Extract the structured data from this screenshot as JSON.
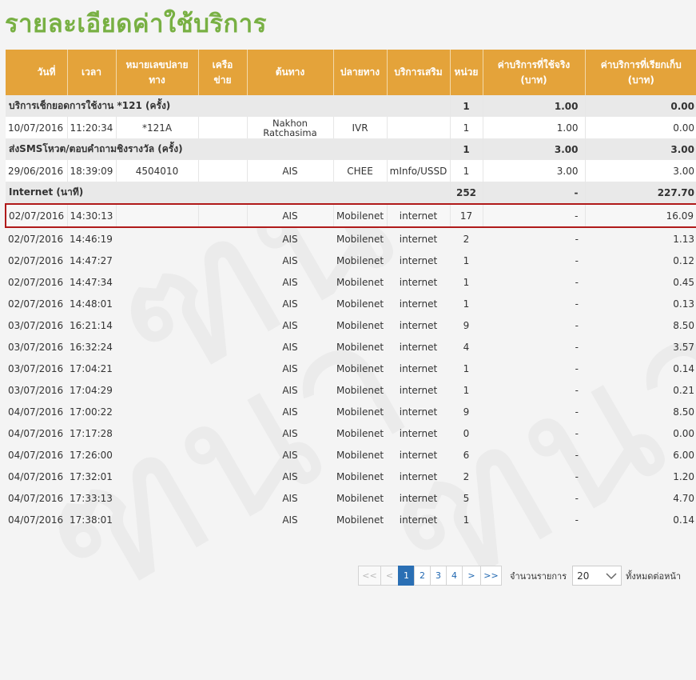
{
  "page": {
    "title": "รายละเอียดค่าใช้บริการ"
  },
  "table": {
    "headers": [
      "วันที่",
      "เวลา",
      "หมายเลขปลายทาง",
      "เครือข่าย",
      "ต้นทาง",
      "ปลายทาง",
      "บริการเสริม",
      "หน่วย",
      "ค่าบริการที่ใช้จริง (บาท)",
      "ค่าบริการที่เรียกเก็บ (บาท)"
    ],
    "groups": [
      {
        "title": "บริการเช็กยอดการใช้งาน *121 (ครั้ง)",
        "units": "1",
        "actual": "1.00",
        "charged": "0.00"
      },
      {
        "title": "ส่งSMSโหวต/ตอบคำถามชิงรางวัล (ครั้ง)",
        "units": "1",
        "actual": "3.00",
        "charged": "3.00"
      },
      {
        "title": "Internet (นาที)",
        "units": "252",
        "actual": "-",
        "charged": "227.70"
      }
    ],
    "group1_rows": [
      {
        "date": "10/07/2016",
        "time": "11:20:34",
        "number": "*121A",
        "network": "",
        "origin": "Nakhon Ratchasima",
        "dest": "IVR",
        "addon": "",
        "units": "1",
        "actual": "1.00",
        "charged": "0.00"
      }
    ],
    "group2_rows": [
      {
        "date": "29/06/2016",
        "time": "18:39:09",
        "number": "4504010",
        "network": "",
        "origin": "AIS",
        "dest": "CHEE",
        "addon": "mInfo/USSD",
        "units": "1",
        "actual": "3.00",
        "charged": "3.00"
      }
    ],
    "group3_rows": [
      {
        "date": "02/07/2016",
        "time": "14:30:13",
        "origin": "AIS",
        "dest": "Mobilenet",
        "addon": "internet",
        "units": "17",
        "actual": "-",
        "charged": "16.09"
      },
      {
        "date": "02/07/2016",
        "time": "14:46:19",
        "origin": "AIS",
        "dest": "Mobilenet",
        "addon": "internet",
        "units": "2",
        "actual": "-",
        "charged": "1.13"
      },
      {
        "date": "02/07/2016",
        "time": "14:47:27",
        "origin": "AIS",
        "dest": "Mobilenet",
        "addon": "internet",
        "units": "1",
        "actual": "-",
        "charged": "0.12"
      },
      {
        "date": "02/07/2016",
        "time": "14:47:34",
        "origin": "AIS",
        "dest": "Mobilenet",
        "addon": "internet",
        "units": "1",
        "actual": "-",
        "charged": "0.45"
      },
      {
        "date": "02/07/2016",
        "time": "14:48:01",
        "origin": "AIS",
        "dest": "Mobilenet",
        "addon": "internet",
        "units": "1",
        "actual": "-",
        "charged": "0.13"
      },
      {
        "date": "03/07/2016",
        "time": "16:21:14",
        "origin": "AIS",
        "dest": "Mobilenet",
        "addon": "internet",
        "units": "9",
        "actual": "-",
        "charged": "8.50"
      },
      {
        "date": "03/07/2016",
        "time": "16:32:24",
        "origin": "AIS",
        "dest": "Mobilenet",
        "addon": "internet",
        "units": "4",
        "actual": "-",
        "charged": "3.57"
      },
      {
        "date": "03/07/2016",
        "time": "17:04:21",
        "origin": "AIS",
        "dest": "Mobilenet",
        "addon": "internet",
        "units": "1",
        "actual": "-",
        "charged": "0.14"
      },
      {
        "date": "03/07/2016",
        "time": "17:04:29",
        "origin": "AIS",
        "dest": "Mobilenet",
        "addon": "internet",
        "units": "1",
        "actual": "-",
        "charged": "0.21"
      },
      {
        "date": "04/07/2016",
        "time": "17:00:22",
        "origin": "AIS",
        "dest": "Mobilenet",
        "addon": "internet",
        "units": "9",
        "actual": "-",
        "charged": "8.50"
      },
      {
        "date": "04/07/2016",
        "time": "17:17:28",
        "origin": "AIS",
        "dest": "Mobilenet",
        "addon": "internet",
        "units": "0",
        "actual": "-",
        "charged": "0.00"
      },
      {
        "date": "04/07/2016",
        "time": "17:26:00",
        "origin": "AIS",
        "dest": "Mobilenet",
        "addon": "internet",
        "units": "6",
        "actual": "-",
        "charged": "6.00"
      },
      {
        "date": "04/07/2016",
        "time": "17:32:01",
        "origin": "AIS",
        "dest": "Mobilenet",
        "addon": "internet",
        "units": "2",
        "actual": "-",
        "charged": "1.20"
      },
      {
        "date": "04/07/2016",
        "time": "17:33:13",
        "origin": "AIS",
        "dest": "Mobilenet",
        "addon": "internet",
        "units": "5",
        "actual": "-",
        "charged": "4.70"
      },
      {
        "date": "04/07/2016",
        "time": "17:38:01",
        "origin": "AIS",
        "dest": "Mobilenet",
        "addon": "internet",
        "units": "1",
        "actual": "-",
        "charged": "0.14"
      }
    ]
  },
  "pagination": {
    "first": "<<",
    "prev": "<",
    "pages": [
      "1",
      "2",
      "3",
      "4"
    ],
    "next": ">",
    "last": ">>",
    "per_page_label": "จำนวนรายการ",
    "per_page_value": "20",
    "suffix_label": "ทั้งหมดต่อหน้า"
  },
  "colors": {
    "title": "#78b043",
    "header": "#e4a33a",
    "highlight": "#b01a1a",
    "active_page": "#2a6fb4"
  }
}
